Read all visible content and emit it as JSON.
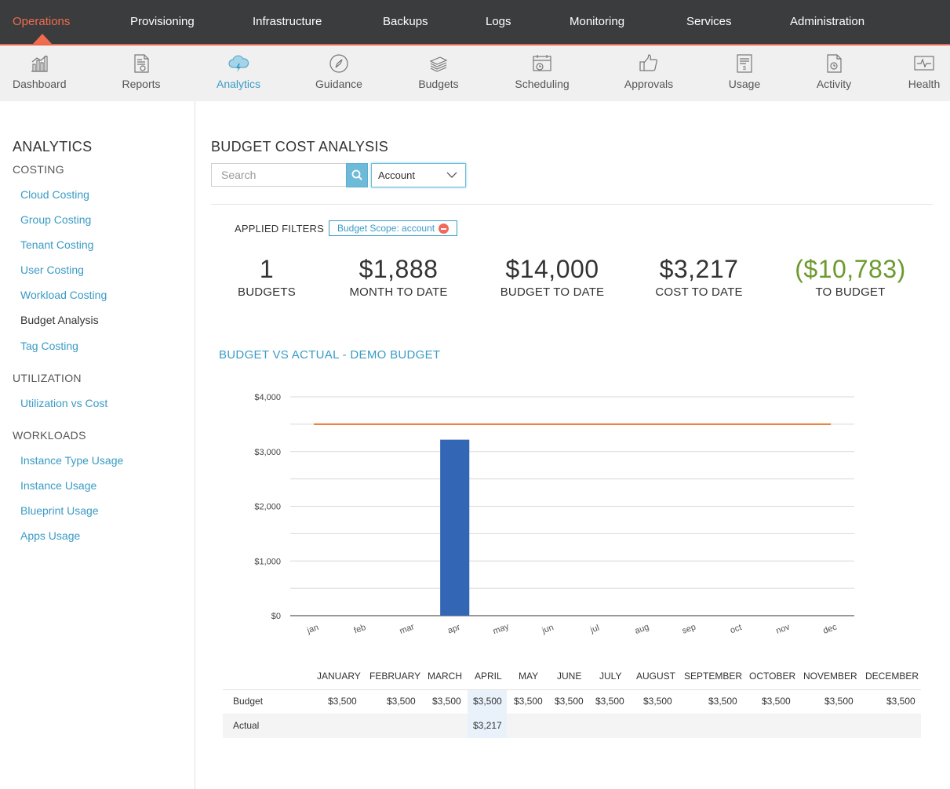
{
  "top_nav": {
    "items": [
      "Operations",
      "Provisioning",
      "Infrastructure",
      "Backups",
      "Logs",
      "Monitoring",
      "Services",
      "Administration"
    ],
    "active": "Operations"
  },
  "sub_nav": {
    "items": [
      {
        "label": "Dashboard",
        "icon": "dashboard-icon"
      },
      {
        "label": "Reports",
        "icon": "reports-icon"
      },
      {
        "label": "Analytics",
        "icon": "analytics-cloud-icon"
      },
      {
        "label": "Guidance",
        "icon": "compass-icon"
      },
      {
        "label": "Budgets",
        "icon": "money-stack-icon"
      },
      {
        "label": "Scheduling",
        "icon": "calendar-clock-icon"
      },
      {
        "label": "Approvals",
        "icon": "thumbs-up-icon"
      },
      {
        "label": "Usage",
        "icon": "usage-icon"
      },
      {
        "label": "Activity",
        "icon": "activity-icon"
      },
      {
        "label": "Health",
        "icon": "heartbeat-icon"
      }
    ],
    "active": "Analytics"
  },
  "sidebar": {
    "title": "ANALYTICS",
    "sections": [
      {
        "heading": "COSTING",
        "links": [
          "Cloud Costing",
          "Group Costing",
          "Tenant Costing",
          "User Costing",
          "Workload Costing",
          "Budget Analysis",
          "Tag Costing"
        ]
      },
      {
        "heading": "UTILIZATION",
        "links": [
          "Utilization vs Cost"
        ]
      },
      {
        "heading": "WORKLOADS",
        "links": [
          "Instance Type Usage",
          "Instance Usage",
          "Blueprint Usage",
          "Apps Usage"
        ]
      }
    ],
    "current": "Budget Analysis"
  },
  "main": {
    "title": "BUDGET COST ANALYSIS",
    "search": {
      "placeholder": "Search",
      "value": ""
    },
    "select": {
      "value": "Account"
    },
    "applied_filters_label": "APPLIED FILTERS",
    "filter_chip": "Budget Scope: account",
    "stats": [
      {
        "value": "1",
        "label": "BUDGETS"
      },
      {
        "value": "$1,888",
        "label": "MONTH TO DATE"
      },
      {
        "value": "$14,000",
        "label": "BUDGET TO DATE"
      },
      {
        "value": "$3,217",
        "label": "COST TO DATE"
      },
      {
        "value": "($10,783)",
        "label": "TO BUDGET",
        "color": "#6c9a2e"
      }
    ],
    "chart_title": "BUDGET VS ACTUAL - DEMO BUDGET"
  },
  "chart_data": {
    "type": "bar",
    "categories": [
      "jan",
      "feb",
      "mar",
      "apr",
      "may",
      "jun",
      "jul",
      "aug",
      "sep",
      "oct",
      "nov",
      "dec"
    ],
    "series": [
      {
        "values": [
          0,
          0,
          0,
          3217,
          0,
          0,
          0,
          0,
          0,
          0,
          0,
          0
        ],
        "color": "#3366b5",
        "kind": "bar"
      },
      {
        "values": [
          3500,
          3500,
          3500,
          3500,
          3500,
          3500,
          3500,
          3500,
          3500,
          3500,
          3500,
          3500
        ],
        "color": "#e8772e",
        "kind": "line"
      }
    ],
    "y_ticks": [
      "$0",
      "$1,000",
      "$2,000",
      "$3,000",
      "$4,000"
    ],
    "ylim": [
      0,
      4000
    ],
    "grid": true
  },
  "table": {
    "columns": [
      "JANUARY",
      "FEBRUARY",
      "MARCH",
      "APRIL",
      "MAY",
      "JUNE",
      "JULY",
      "AUGUST",
      "SEPTEMBER",
      "OCTOBER",
      "NOVEMBER",
      "DECEMBER"
    ],
    "rows": [
      {
        "label": "Budget",
        "values": [
          "$3,500",
          "$3,500",
          "$3,500",
          "$3,500",
          "$3,500",
          "$3,500",
          "$3,500",
          "$3,500",
          "$3,500",
          "$3,500",
          "$3,500",
          "$3,500"
        ]
      },
      {
        "label": "Actual",
        "values": [
          "",
          "",
          "",
          "$3,217",
          "",
          "",
          "",
          "",
          "",
          "",
          "",
          ""
        ]
      }
    ],
    "highlight_color": "#e9f2fb"
  }
}
